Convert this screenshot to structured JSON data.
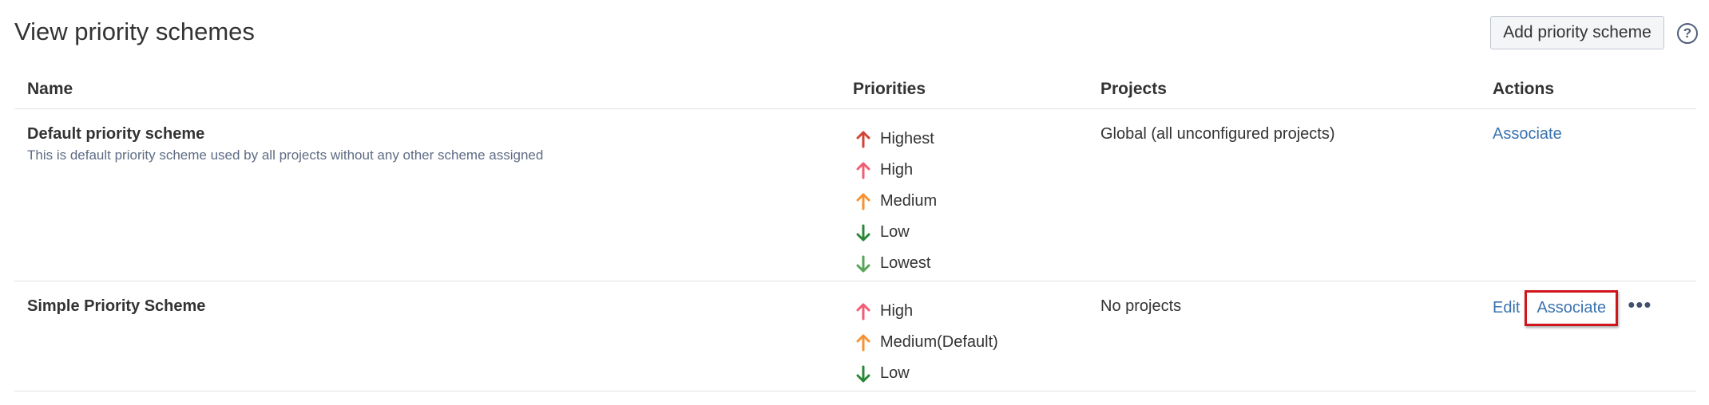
{
  "header": {
    "title": "View priority schemes",
    "add_button": "Add priority scheme",
    "help_icon": "help-icon"
  },
  "table": {
    "columns": [
      "Name",
      "Priorities",
      "Projects",
      "Actions"
    ],
    "rows": [
      {
        "name": "Default priority scheme",
        "description": "This is default priority scheme used by all projects without any other scheme assigned",
        "priorities": [
          {
            "label": "Highest",
            "icon": "arrow-up-icon",
            "color": "#d04437"
          },
          {
            "label": "High",
            "icon": "arrow-up-icon",
            "color": "#f15c75"
          },
          {
            "label": "Medium",
            "icon": "arrow-up-icon",
            "color": "#f79232"
          },
          {
            "label": "Low",
            "icon": "arrow-down-icon",
            "color": "#2a8735"
          },
          {
            "label": "Lowest",
            "icon": "arrow-down-icon",
            "color": "#55a557"
          }
        ],
        "projects": "Global (all unconfigured projects)",
        "actions": {
          "associate": "Associate"
        }
      },
      {
        "name": "Simple Priority Scheme",
        "description": "",
        "priorities": [
          {
            "label": "High",
            "icon": "arrow-up-icon",
            "color": "#f15c75"
          },
          {
            "label": "Medium(Default)",
            "icon": "arrow-up-icon",
            "color": "#f79232"
          },
          {
            "label": "Low",
            "icon": "arrow-down-icon",
            "color": "#2a8735"
          }
        ],
        "projects": "No projects",
        "actions": {
          "edit": "Edit",
          "associate": "Associate",
          "more": "•••"
        }
      }
    ]
  },
  "colors": {
    "link": "#3b73af",
    "highlight": "#d0161b"
  }
}
